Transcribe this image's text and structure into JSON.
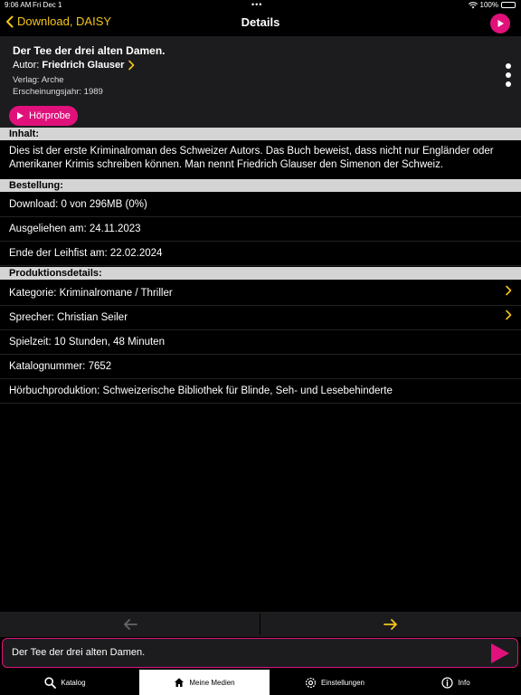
{
  "status": {
    "time": "9:06 AM",
    "date": "Fri Dec 1",
    "battery": "100%"
  },
  "nav": {
    "back_label": "Download, DAISY",
    "title": "Details"
  },
  "book": {
    "title": "Der Tee der drei alten Damen.",
    "author_label": "Autor:",
    "author": "Friedrich Glauser",
    "publisher": "Verlag: Arche",
    "year": "Erscheinungsjahr: 1989",
    "preview_label": "Hörprobe"
  },
  "sections": {
    "content_head": "Inhalt:",
    "content_text": "Dies ist der erste Kriminalroman des Schweizer Autors. Das Buch beweist, dass nicht nur Engländer oder Amerikaner Krimis schreiben können. Man nennt Friedrich Glauser den Simenon der Schweiz.",
    "order_head": "Bestellung:",
    "order_rows": [
      "Download: 0 von 296MB (0%)",
      "Ausgeliehen am: 24.11.2023",
      "Ende der Leihfist am: 22.02.2024"
    ],
    "production_head": "Produktionsdetails:",
    "production_rows": [
      "Kategorie: Kriminalromane / Thriller",
      "Sprecher: Christian Seiler",
      "Spielzeit: 10 Stunden, 48 Minuten",
      "Katalognummer: 7652",
      "Hörbuchproduktion: Schweizerische Bibliothek für Blinde, Seh- und Lesebehinderte"
    ]
  },
  "player": {
    "title": "Der Tee der drei alten Damen."
  },
  "tabs": [
    {
      "label": "Katalog"
    },
    {
      "label": "Meine Medien"
    },
    {
      "label": "Einstellungen"
    },
    {
      "label": "Info"
    }
  ],
  "colors": {
    "accent": "#f5c518",
    "brand": "#e0117b"
  }
}
